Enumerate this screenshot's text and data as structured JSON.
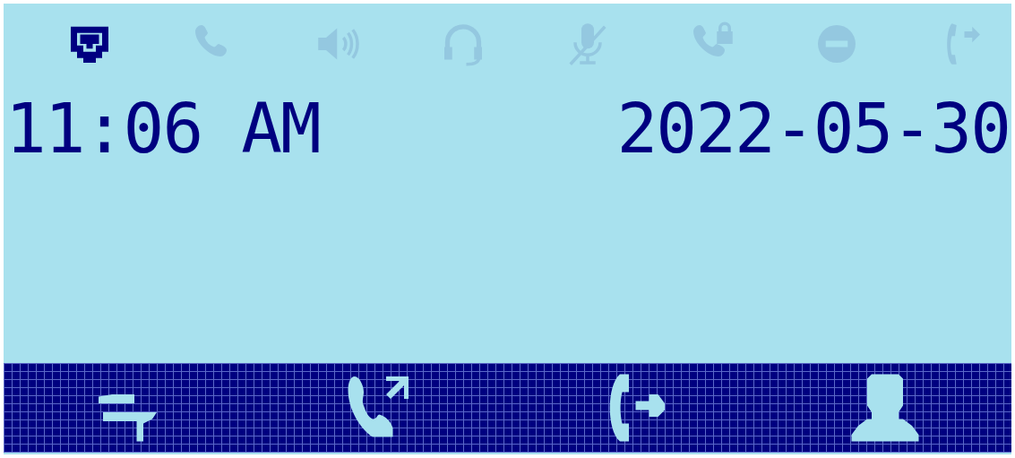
{
  "status_icons": [
    {
      "kind": "network",
      "on": true
    },
    {
      "kind": "phone",
      "on": false
    },
    {
      "kind": "speaker",
      "on": false
    },
    {
      "kind": "headset",
      "on": false
    },
    {
      "kind": "mute",
      "on": false
    },
    {
      "kind": "lock-call",
      "on": false
    },
    {
      "kind": "dnd",
      "on": false
    },
    {
      "kind": "forward",
      "on": false
    }
  ],
  "time": "11:06 AM",
  "date": "2022-05-30",
  "softkeys": [
    {
      "kind": "transfer"
    },
    {
      "kind": "call-log"
    },
    {
      "kind": "forward-call"
    },
    {
      "kind": "contacts"
    }
  ]
}
